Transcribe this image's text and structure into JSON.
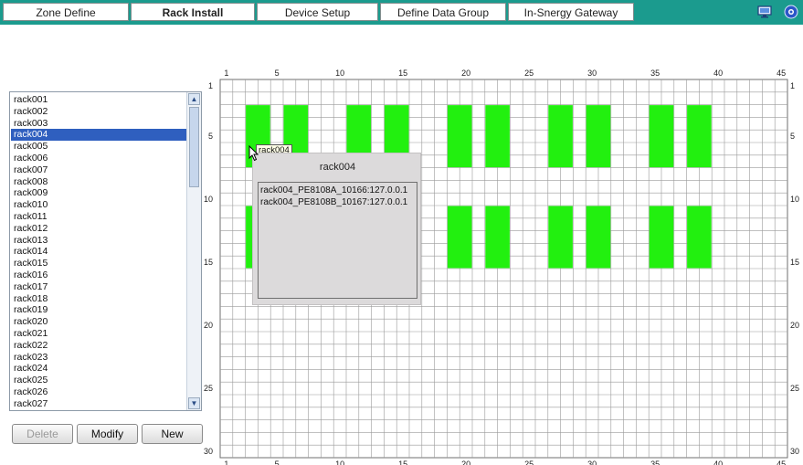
{
  "tabs": [
    {
      "label": "Zone Define",
      "active": false
    },
    {
      "label": "Rack Install",
      "active": true
    },
    {
      "label": "Device Setup",
      "active": false
    },
    {
      "label": "Define Data Group",
      "active": false
    },
    {
      "label": "In-Snergy Gateway",
      "active": false
    }
  ],
  "top_icons": [
    "monitor-icon",
    "info-icon"
  ],
  "rack_list": {
    "items": [
      "rack001",
      "rack002",
      "rack003",
      "rack004",
      "rack005",
      "rack006",
      "rack007",
      "rack008",
      "rack009",
      "rack010",
      "rack011",
      "rack012",
      "rack013",
      "rack014",
      "rack015",
      "rack016",
      "rack017",
      "rack018",
      "rack019",
      "rack020",
      "rack021",
      "rack022",
      "rack023",
      "rack024",
      "rack025",
      "rack026",
      "rack027"
    ],
    "selected": "rack004"
  },
  "buttons": {
    "delete": "Delete",
    "modify": "Modify",
    "new": "New"
  },
  "grid": {
    "columns": 45,
    "rows": 30,
    "x_ticks": [
      "1",
      "5",
      "10",
      "15",
      "20",
      "25",
      "30",
      "35",
      "40",
      "45"
    ],
    "y_ticks": [
      "1",
      "5",
      "10",
      "15",
      "20",
      "25",
      "30"
    ],
    "rack_color": "#22f00f"
  },
  "tooltip": "rack004",
  "popup": {
    "title": "rack004",
    "entries": [
      "rack004_PE8108A_10166:127.0.0.1",
      "rack004_PE8108B_10167:127.0.0.1"
    ]
  },
  "colors": {
    "topbar": "#1b9b8e",
    "selection": "#2f5fbf"
  }
}
